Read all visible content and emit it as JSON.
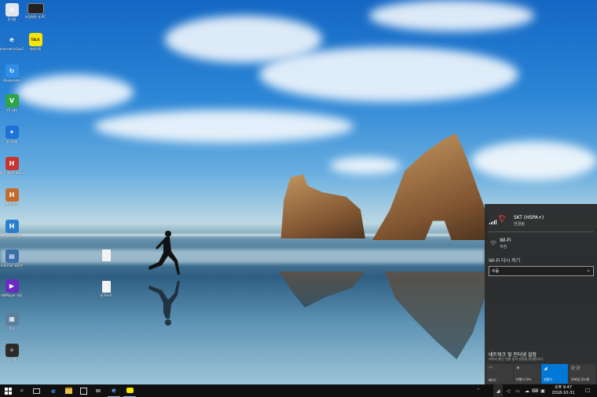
{
  "desktop_icons": [
    {
      "label": "휴지통",
      "icon": "recycle-bin-icon",
      "color": "#e0e6ee",
      "glyph": "♻"
    },
    {
      "label": "바탕화면 내 PC",
      "icon": "monitor-icon",
      "color": "#222222",
      "glyph": ""
    },
    {
      "label": "Internet eGovFrame",
      "icon": "globe-icon",
      "color": "#1e73c8",
      "glyph": "e"
    },
    {
      "label": "카카오톡",
      "icon": "kakaotalk-icon",
      "color": "#f7e600",
      "glyph": "TALK"
    },
    {
      "label": "Bluepromo",
      "icon": "blue-app-icon",
      "color": "#2f8ee6",
      "glyph": "↻"
    },
    {
      "label": "V3 Lite",
      "icon": "v3-icon",
      "color": "#2da546",
      "glyph": "V"
    },
    {
      "label": "원격지원",
      "icon": "remote-icon",
      "color": "#1d72d8",
      "glyph": "✦"
    },
    {
      "label": "한컴 계정등록/오피스",
      "icon": "hancom-red-icon",
      "color": "#c8352e",
      "glyph": "H"
    },
    {
      "label": "한컴 사전",
      "icon": "hancom-brown-icon",
      "color": "#c46c2a",
      "glyph": "H"
    },
    {
      "label": "한컴 타자연습",
      "icon": "hancom-blue-icon",
      "color": "#2a7fcc",
      "glyph": "H"
    },
    {
      "label": "Internet 제어판",
      "icon": "control-panel-icon",
      "color": "#3c6fa8",
      "glyph": "▤"
    },
    {
      "label": "KMPlayer 파일",
      "icon": "kmplayer-icon",
      "color": "#6b2bbf",
      "glyph": "▶"
    },
    {
      "label": "문서",
      "icon": "landscape-icon",
      "color": "#5b7f9c",
      "glyph": "▦"
    },
    {
      "label": "시스템",
      "icon": "system-icon",
      "color": "#2b2b2b",
      "glyph": "✧"
    },
    {
      "label": "",
      "icon": "document-file-icon",
      "color": "#f2f2f2",
      "glyph": ""
    },
    {
      "label": "새 텍스트",
      "icon": "text-file-icon",
      "color": "#f2f2f2",
      "glyph": ""
    }
  ],
  "network_panel": {
    "connection_name": "SKT (HSPA+)",
    "connection_status": "연결됨",
    "wifi_name": "Wi-Fi",
    "wifi_status": "꺼짐",
    "wifi_reenable_label": "Wi-Fi 다시 켜기",
    "wifi_reenable_value": "수동",
    "settings_title": "네트워크 및 인터넷 설정",
    "settings_desc": "데이터 통신 연결 등의 설정을 변경합니다."
  },
  "quick_actions": [
    {
      "label": "Wi-Fi",
      "icon": "wifi-icon",
      "active": false
    },
    {
      "label": "비행기 모드",
      "icon": "airplane-icon",
      "active": false
    },
    {
      "label": "셀룰러",
      "icon": "cellular-icon",
      "active": true
    },
    {
      "label": "모바일 핫스팟",
      "icon": "hotspot-icon",
      "active": false
    }
  ],
  "colors": {
    "accent": "#0078d7",
    "panel": "#2b2b2b",
    "taskbar": "#101010"
  },
  "clock": {
    "time": "오후 9:47",
    "date": "2018-10-31"
  }
}
